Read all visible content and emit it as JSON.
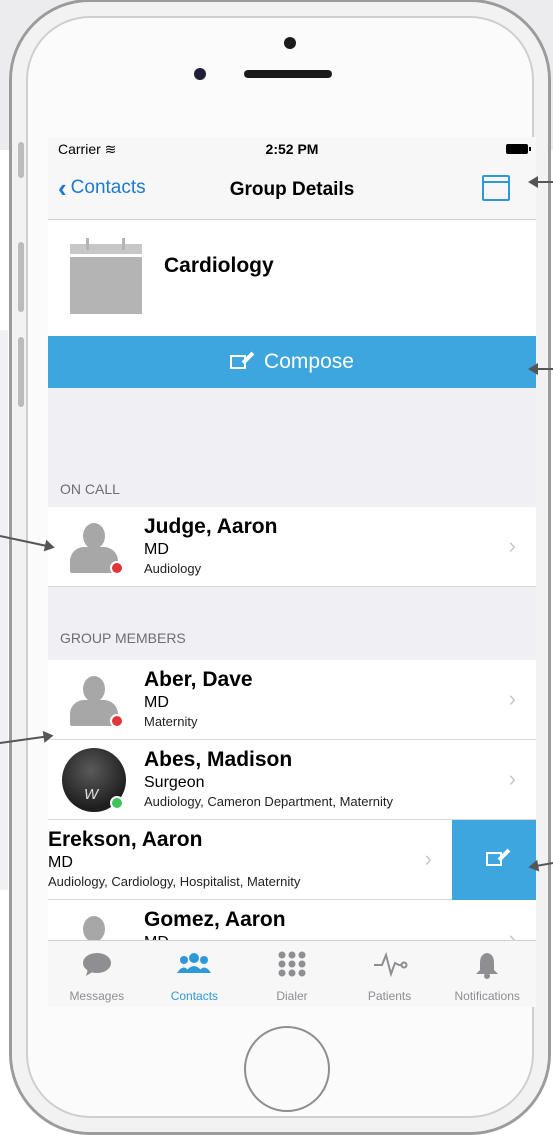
{
  "status": {
    "carrier": "Carrier",
    "time": "2:52 PM"
  },
  "nav": {
    "back_label": "Contacts",
    "title": "Group Details"
  },
  "group": {
    "name": "Cardiology"
  },
  "compose": {
    "label": "Compose"
  },
  "sections": {
    "on_call": "ON CALL",
    "group_members": "GROUP MEMBERS"
  },
  "on_call": [
    {
      "name": "Judge, Aaron",
      "title": "MD",
      "dept": "Audiology",
      "status": "#e0353b"
    }
  ],
  "members": [
    {
      "name": "Aber, Dave",
      "title": "MD",
      "dept": "Maternity",
      "status": "#e0353b"
    },
    {
      "name": "Abes, Madison",
      "title": "Surgeon",
      "dept": "Audiology, Cameron Department, Maternity",
      "status": "#3bc55a",
      "photo_letter": "W"
    },
    {
      "name": "Erekson, Aaron",
      "title": "MD",
      "dept": "Audiology, Cardiology, Hospitalist, Maternity"
    },
    {
      "name": "Gomez, Aaron",
      "title": "MD"
    }
  ],
  "tabs": [
    {
      "label": "Messages",
      "icon": "chat-bubble-icon"
    },
    {
      "label": "Contacts",
      "icon": "contacts-group-icon",
      "active": true
    },
    {
      "label": "Dialer",
      "icon": "keypad-icon"
    },
    {
      "label": "Patients",
      "icon": "heartbeat-icon"
    },
    {
      "label": "Notifications",
      "icon": "bell-icon"
    }
  ],
  "colors": {
    "accent": "#3da6de",
    "tint": "#1e7ad0",
    "offline": "#e0353b",
    "online": "#3bc55a"
  }
}
